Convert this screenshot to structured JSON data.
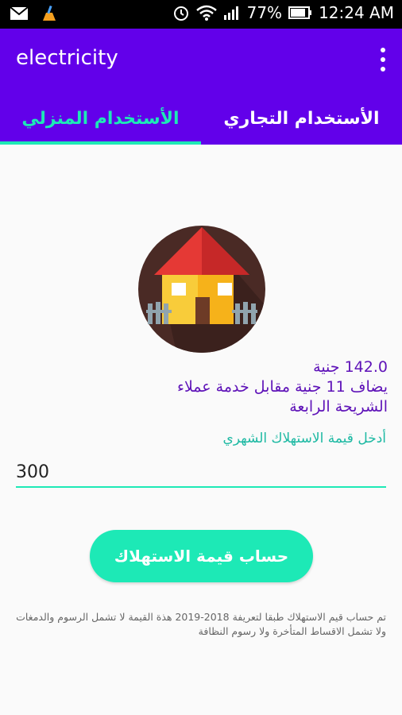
{
  "status_bar": {
    "battery": "77%",
    "time": "12:24 AM"
  },
  "app": {
    "title": "electricity"
  },
  "tabs": [
    {
      "label": "الأستخدام التجاري"
    },
    {
      "label": "الأستخدام المنزلي"
    }
  ],
  "result": {
    "amount": "142.0 جنية",
    "service_fee": "يضاف 11 جنية مقابل خدمة عملاء",
    "tier": "الشريحة الرابعة"
  },
  "input": {
    "hint": "أدخل قيمة الاستهلاك الشهري",
    "value": "300"
  },
  "button": {
    "calculate": "حساب قيمة الاستهلاك"
  },
  "note": "تم حساب قيم الاستهلاك طبقا لتعريفة 2018-2019 هذة القيمة لا تشمل الرسوم والدمغات ولا تشمل الاقساط المتأخرة ولا رسوم النظافة",
  "colors": {
    "primary": "#6200ea",
    "accent": "#1de9b6",
    "result_text": "#5e12b8"
  }
}
